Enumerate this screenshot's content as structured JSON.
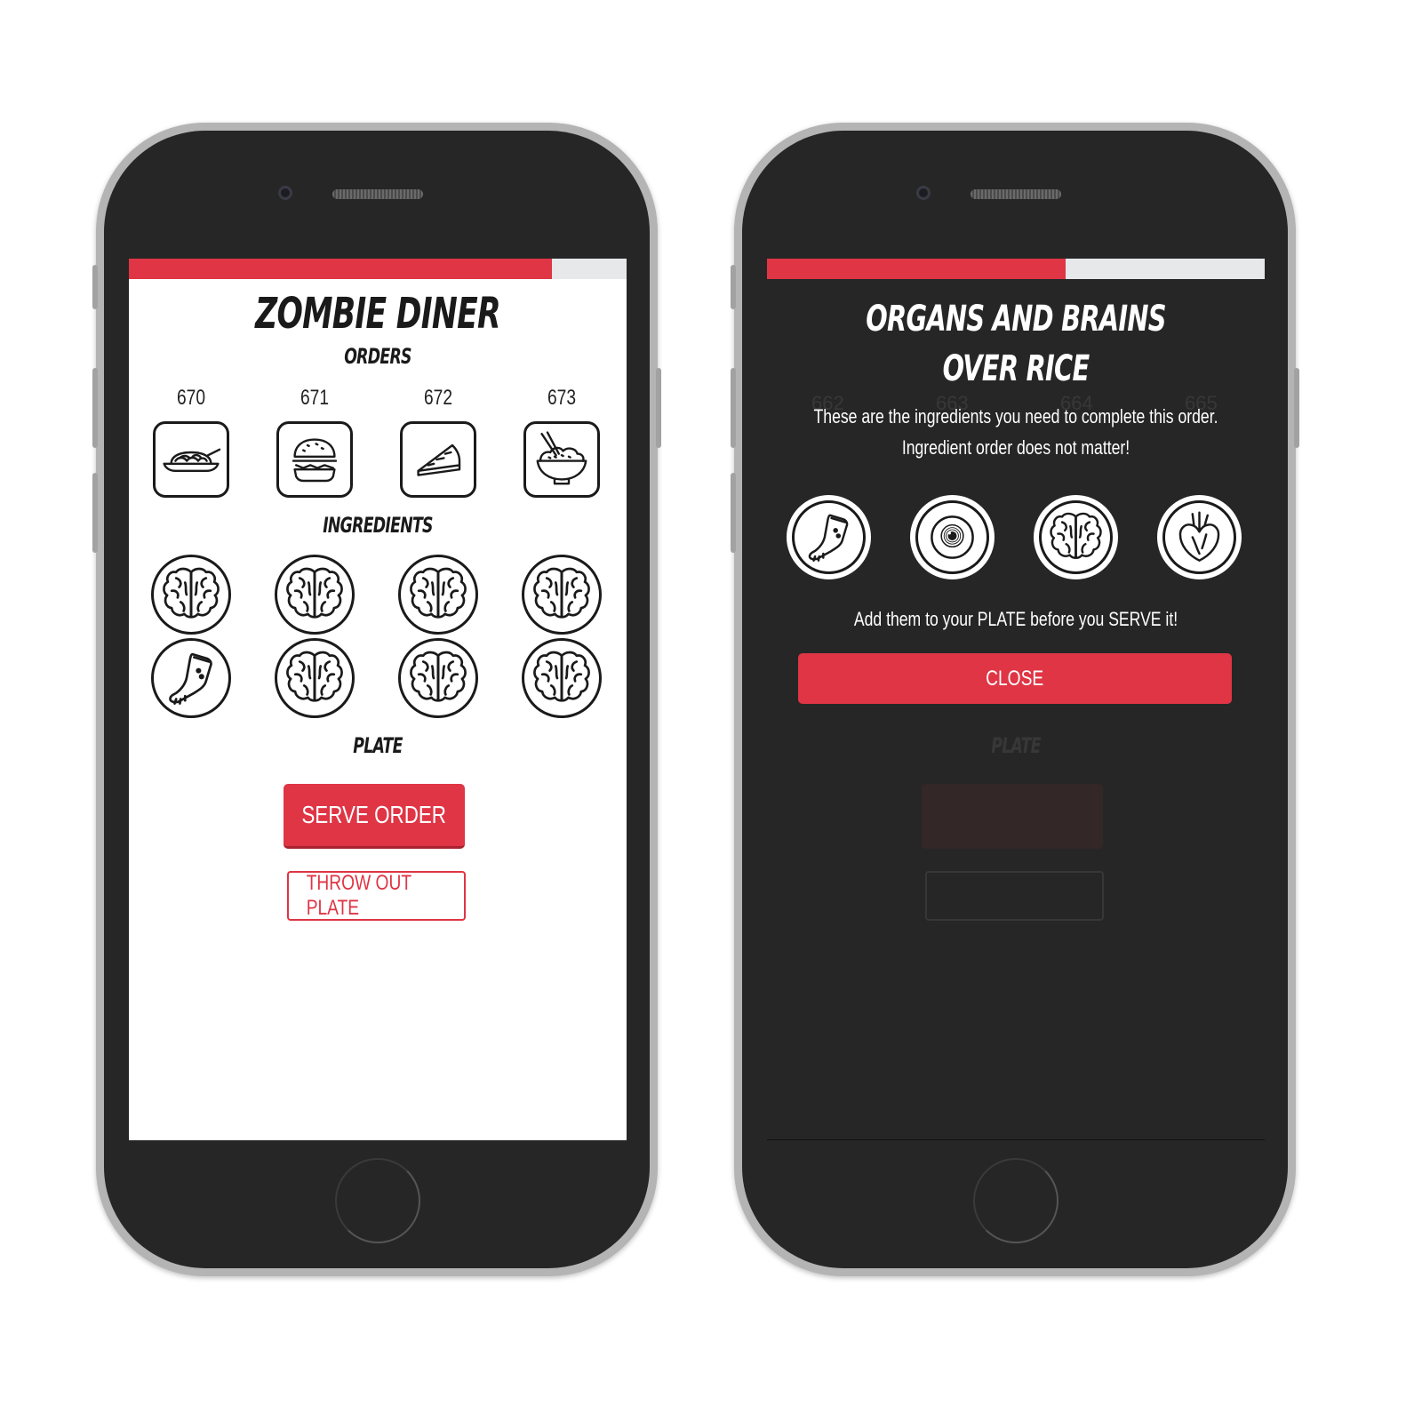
{
  "app": {
    "title": "ZOMBIE DINER",
    "accent_color": "#df3545"
  },
  "game_screen": {
    "progress": 0.85,
    "orders_label": "ORDERS",
    "orders": [
      {
        "number": "670",
        "icon": "spaghetti-icon"
      },
      {
        "number": "671",
        "icon": "burger-icon"
      },
      {
        "number": "672",
        "icon": "pie-slice-icon"
      },
      {
        "number": "673",
        "icon": "rice-bowl-icon"
      }
    ],
    "ingredients_label": "INGREDIENTS",
    "ingredients": [
      "brain-icon",
      "brain-icon",
      "brain-icon",
      "brain-icon",
      "foot-icon",
      "brain-icon",
      "brain-icon",
      "brain-icon"
    ],
    "plate_label": "PLATE",
    "serve_button": "SERVE ORDER",
    "throw_button": "THROW OUT PLATE"
  },
  "modal_screen": {
    "progress": 0.6,
    "title": "ORGANS AND BRAINS OVER RICE",
    "description": "These are the ingredients you need to complete this order. Ingredient order does not matter!",
    "required_ingredients": [
      "foot-icon",
      "eyeball-icon",
      "brain-icon",
      "heart-icon"
    ],
    "instruction": "Add them to your PLATE before you SERVE it!",
    "close_button": "CLOSE",
    "background_orders": [
      "662",
      "663",
      "664",
      "665"
    ]
  }
}
